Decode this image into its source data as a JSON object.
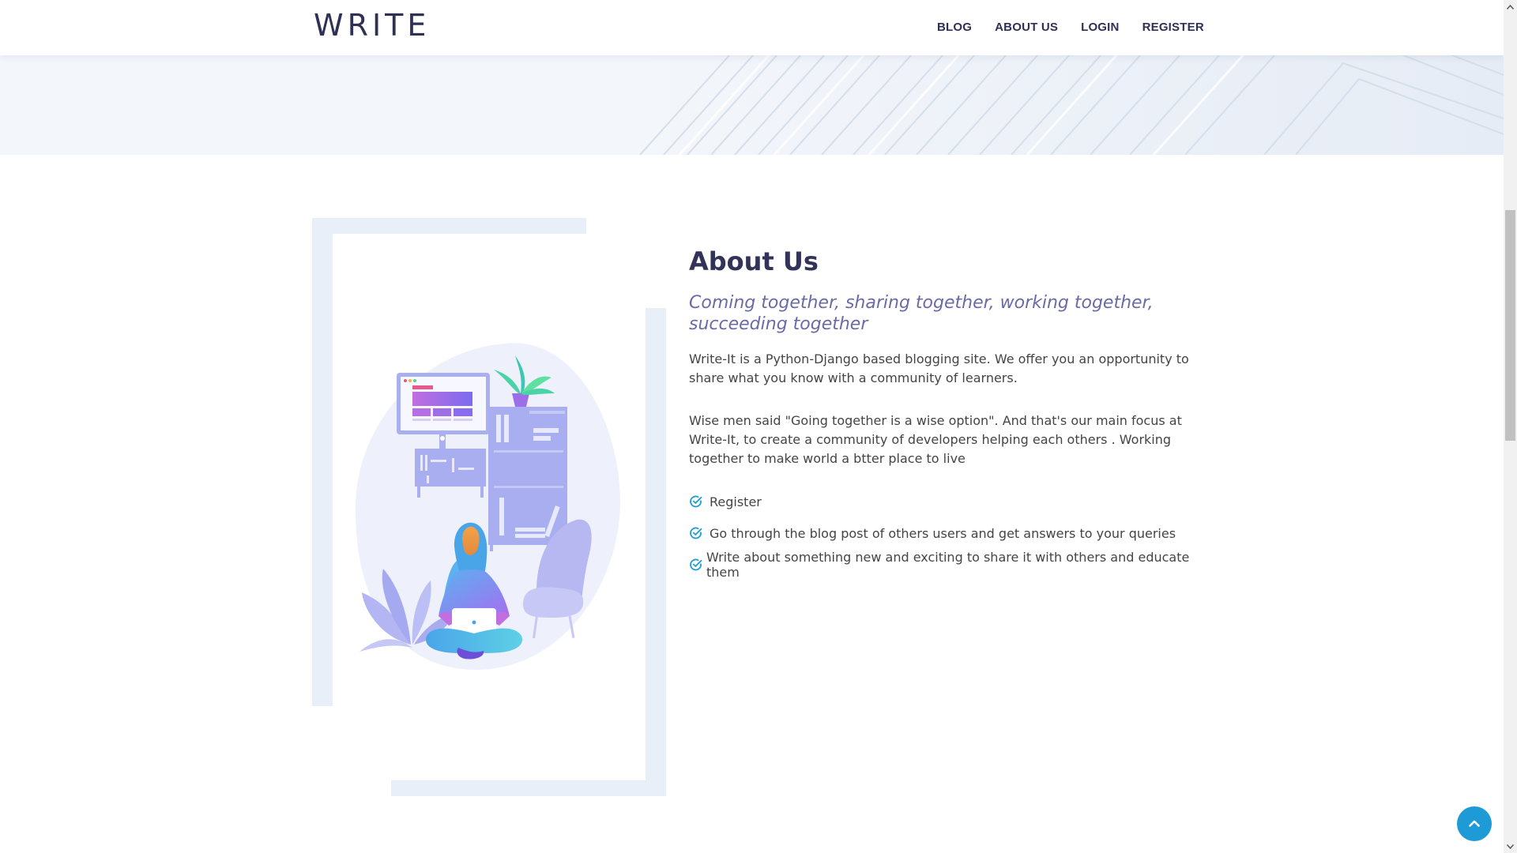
{
  "brand": {
    "logo": "WRITE"
  },
  "nav": {
    "items": [
      "BLOG",
      "ABOUT US",
      "LOGIN",
      "REGISTER"
    ]
  },
  "about": {
    "title": "About Us",
    "tagline": "Coming together, sharing together, working together, succeeding together",
    "paragraphs": [
      "Write-It is a Python-Django based blogging site. We offer you an opportunity to share what you know with a community of learners.",
      "Wise men said \"Going together is a wise option\". And that's our main focus at Write-It, to create a community of developers helping each others . Working together to make world a btter place to live"
    ],
    "steps": [
      "Register",
      "Go through the blog post of others users and get answers to your queries",
      "Write about something new and exciting to share it with others and educate them"
    ]
  },
  "icons": {
    "check": "check-circle-icon",
    "back_to_top": "chevron-up-icon"
  },
  "colors": {
    "accent": "#1e9bd7",
    "heading": "#33335a",
    "tagline": "#6a6aa8",
    "frame": "#e9eff9"
  }
}
